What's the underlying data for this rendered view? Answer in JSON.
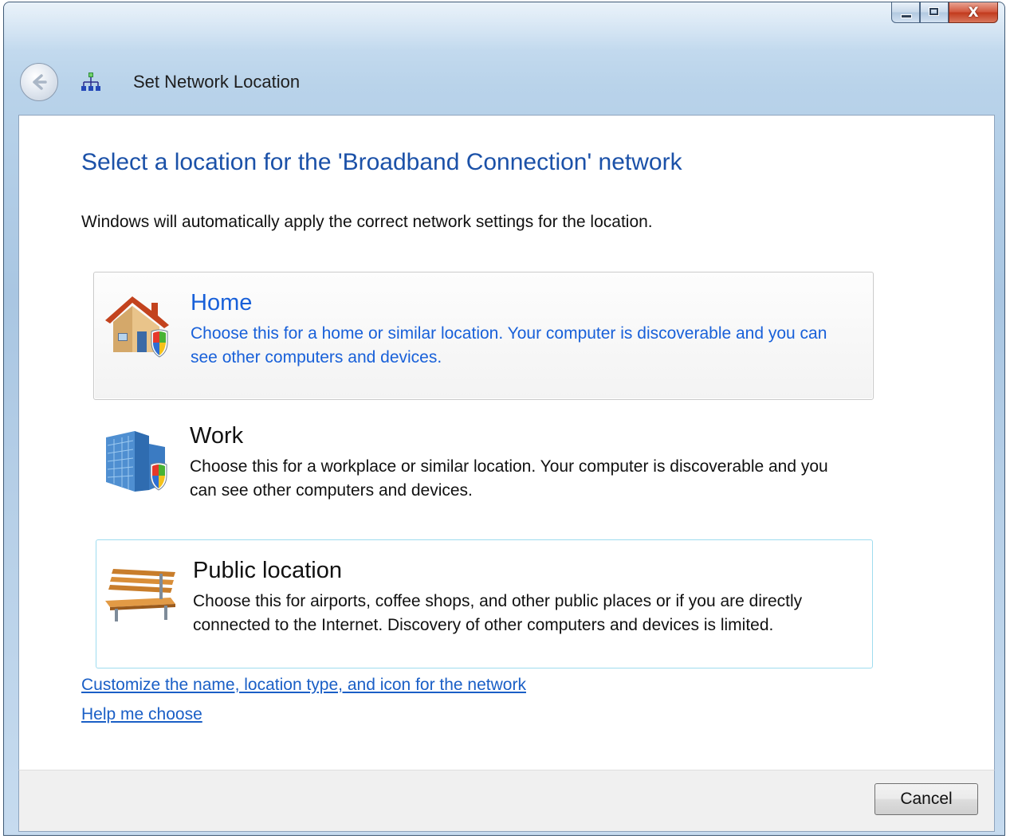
{
  "window": {
    "title": "Set Network Location",
    "caption": {
      "minimize": "minimize",
      "maximize": "maximize",
      "close": "X"
    }
  },
  "content": {
    "heading": "Select a location for the 'Broadband Connection' network",
    "instructions": "Windows will automatically apply the correct network settings for the location.",
    "options": [
      {
        "title": "Home",
        "description": "Choose this for a home or similar location. Your computer is discoverable and you can see other computers and devices.",
        "icon": "home-shield-icon"
      },
      {
        "title": "Work",
        "description": "Choose this for a workplace or similar location. Your computer is discoverable and you can see other computers and devices.",
        "icon": "office-building-shield-icon"
      },
      {
        "title": "Public location",
        "description": "Choose this for airports, coffee shops, and other public places or if you are directly connected to the Internet. Discovery of other computers and devices is limited.",
        "icon": "park-bench-icon"
      }
    ],
    "links": {
      "customize": "Customize the name, location type, and icon for the network",
      "help": "Help me choose"
    }
  },
  "footer": {
    "cancel_label": "Cancel"
  },
  "colors": {
    "heading": "#1b51a8",
    "hover_text": "#1860d9",
    "link": "#1a5fc6",
    "focus_border": "#9fdcef"
  }
}
